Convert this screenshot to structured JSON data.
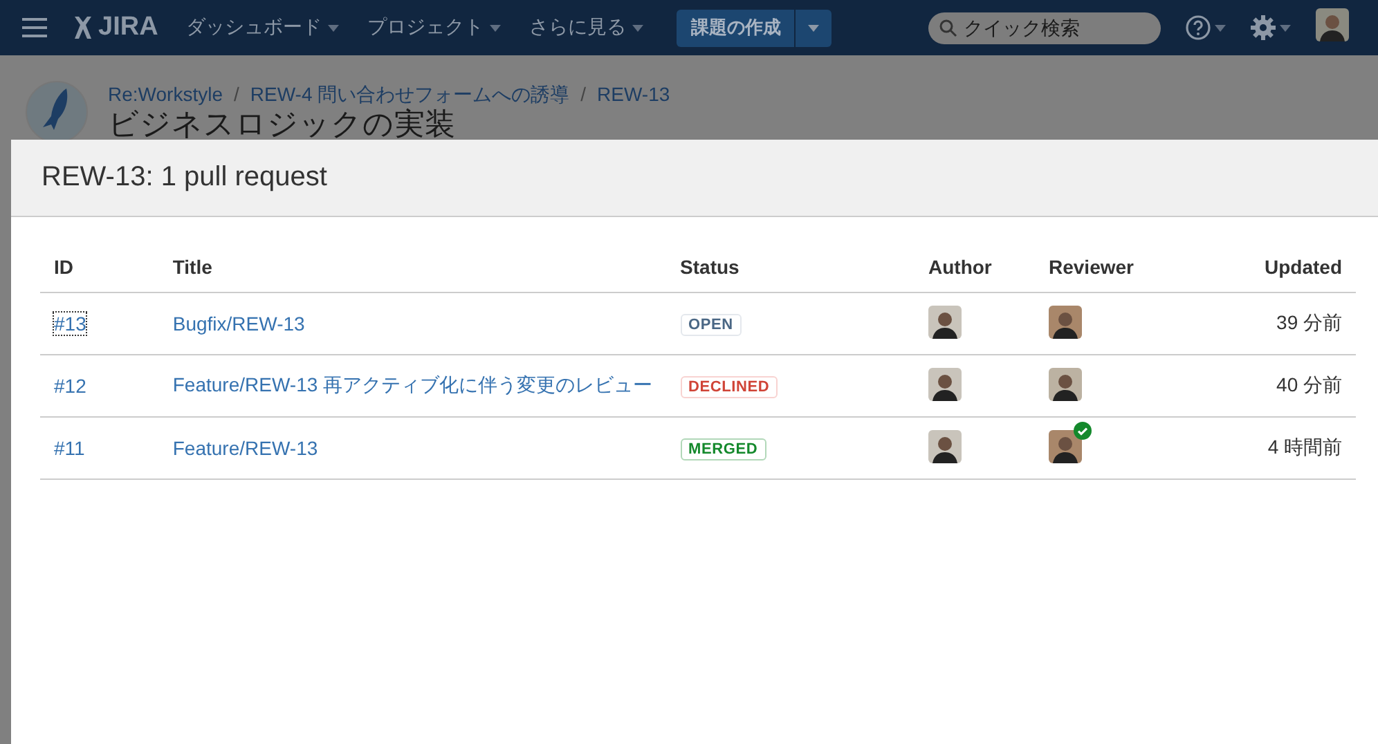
{
  "header": {
    "logo": "JIRA",
    "nav": [
      {
        "label": "ダッシュボード"
      },
      {
        "label": "プロジェクト"
      },
      {
        "label": "さらに見る"
      }
    ],
    "create_button": "課題の作成",
    "search": {
      "placeholder": "クイック検索"
    }
  },
  "page": {
    "breadcrumbs": [
      {
        "label": "Re:Workstyle",
        "separator": "/"
      },
      {
        "label": "REW-4 問い合わせフォームへの誘導",
        "separator": "/"
      },
      {
        "label": "REW-13"
      }
    ],
    "title": "ビジネスロジックの実装"
  },
  "dialog": {
    "title": "REW-13: 1 pull request",
    "table": {
      "columns": [
        "ID",
        "Title",
        "Status",
        "Author",
        "Reviewer",
        "Updated"
      ],
      "rows": [
        {
          "id": "#13",
          "focused": true,
          "title": "Bugfix/REW-13",
          "status": {
            "label": "OPEN",
            "kind": "open"
          },
          "reviewer_approved": false,
          "updated": "39 分前"
        },
        {
          "id": "#12",
          "focused": false,
          "title": "Feature/REW-13 再アクティブ化に伴う変更のレビュー",
          "status": {
            "label": "DECLINED",
            "kind": "declined"
          },
          "reviewer_approved": false,
          "updated": "40 分前"
        },
        {
          "id": "#11",
          "focused": false,
          "title": "Feature/REW-13",
          "status": {
            "label": "MERGED",
            "kind": "merged"
          },
          "reviewer_approved": true,
          "updated": "4 時間前"
        }
      ]
    }
  }
}
